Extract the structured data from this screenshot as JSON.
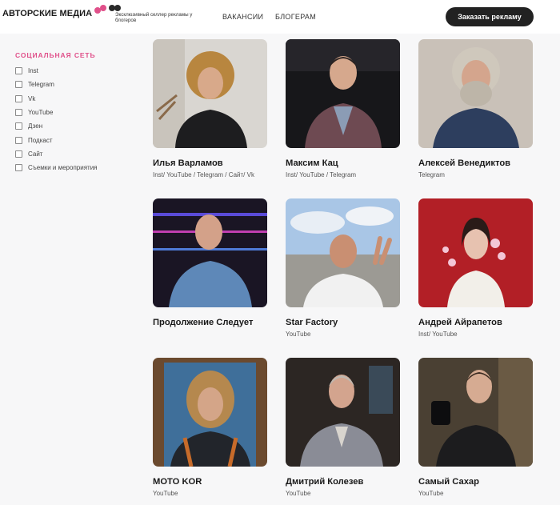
{
  "header": {
    "logo_text": "АВТОРСКИЕ МЕДИА",
    "tagline": "Эксклюзивный селлер рекламы у блогеров",
    "nav": [
      "ВАКАНСИИ",
      "БЛОГЕРАМ"
    ],
    "cta_label": "Заказать рекламу",
    "colors": {
      "brand_pink": "#e0508a",
      "button_bg": "#222222"
    }
  },
  "sidebar": {
    "title": "СОЦИАЛЬНАЯ СЕТЬ",
    "filters": [
      "Inst",
      "Telegram",
      "Vk",
      "YouTube",
      "Дзен",
      "Подкаст",
      "Сайт",
      "Съемки и мероприятия"
    ]
  },
  "bloggers": [
    {
      "name": "Илья Варламов",
      "platforms": "Inst/ YouTube / Telegram / Сайт/ Vk"
    },
    {
      "name": "Максим Кац",
      "platforms": "Inst/ YouTube / Telegram"
    },
    {
      "name": "Алексей Венедиктов",
      "platforms": "Telegram"
    },
    {
      "name": "Продолжение Следует",
      "platforms": ""
    },
    {
      "name": "Star Factory",
      "platforms": "YouTube"
    },
    {
      "name": "Андрей Айрапетов",
      "platforms": "Inst/ YouTube"
    },
    {
      "name": "MOTO KOR",
      "platforms": "YouTube"
    },
    {
      "name": "Дмитрий Колезев",
      "platforms": "YouTube"
    },
    {
      "name": "Самый Сахар",
      "platforms": "YouTube"
    }
  ]
}
